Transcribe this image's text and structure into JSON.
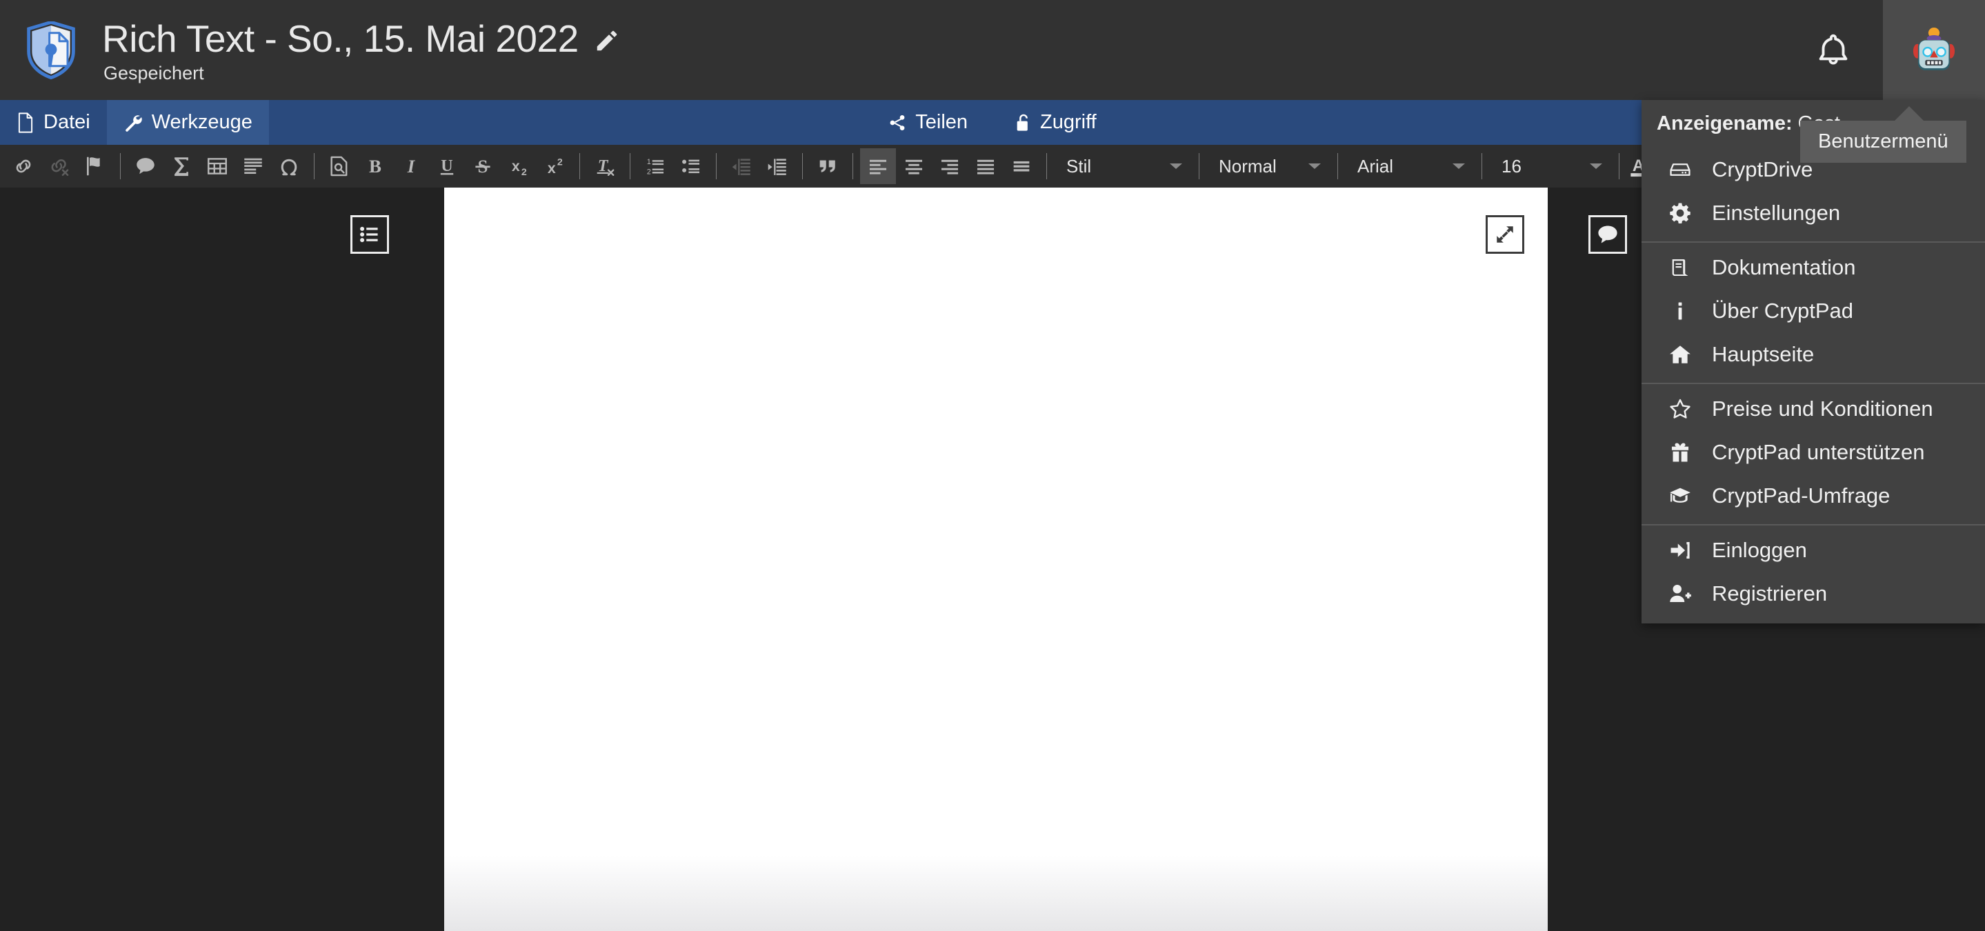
{
  "header": {
    "logo_icon": "cryptpad-shield-logo",
    "document_title": "Rich Text - So., 15. Mai 2022",
    "edit_title_icon": "pencil-icon",
    "save_status": "Gespeichert",
    "notifications_icon": "bell-icon",
    "avatar_icon": "robot-avatar",
    "avatar_emoji": "🤖"
  },
  "bluebar": {
    "left_items": [
      {
        "label": "Datei",
        "icon": "file-icon",
        "active": false
      },
      {
        "label": "Werkzeuge",
        "icon": "wrench-icon",
        "active": true
      }
    ],
    "center_items": [
      {
        "label": "Teilen",
        "icon": "share-icon"
      },
      {
        "label": "Zugriff",
        "icon": "lock-open-icon"
      }
    ]
  },
  "toolbar": {
    "buttons": [
      {
        "name": "link-icon",
        "state": "normal"
      },
      {
        "name": "unlink-icon",
        "state": "dim"
      },
      {
        "name": "flag-icon",
        "state": "normal"
      },
      {
        "name": "comment-icon",
        "state": "normal"
      },
      {
        "name": "sigma-icon",
        "state": "normal"
      },
      {
        "name": "table-icon",
        "state": "normal"
      },
      {
        "name": "paragraph-lines-icon",
        "state": "normal"
      },
      {
        "name": "omega-icon",
        "state": "normal"
      },
      {
        "name": "page-preview-icon",
        "state": "normal"
      },
      {
        "name": "bold-icon",
        "state": "normal"
      },
      {
        "name": "italic-icon",
        "state": "normal"
      },
      {
        "name": "underline-icon",
        "state": "normal"
      },
      {
        "name": "strikethrough-icon",
        "state": "normal"
      },
      {
        "name": "subscript-icon",
        "state": "normal"
      },
      {
        "name": "superscript-icon",
        "state": "normal"
      },
      {
        "name": "remove-format-icon",
        "state": "normal"
      },
      {
        "name": "numbered-list-icon",
        "state": "normal"
      },
      {
        "name": "bullet-list-icon",
        "state": "normal"
      },
      {
        "name": "outdent-icon",
        "state": "dim"
      },
      {
        "name": "indent-icon",
        "state": "normal"
      },
      {
        "name": "blockquote-icon",
        "state": "normal"
      },
      {
        "name": "align-left-icon",
        "state": "active"
      },
      {
        "name": "align-center-icon",
        "state": "normal"
      },
      {
        "name": "align-right-icon",
        "state": "normal"
      },
      {
        "name": "align-justify-icon",
        "state": "normal"
      },
      {
        "name": "paragraph-format-icon",
        "state": "normal"
      }
    ],
    "labels": {
      "bold": "B",
      "italic": "I",
      "underline": "U",
      "strike": "S",
      "highlight_letter": "A"
    },
    "selects": {
      "style": "Stil",
      "paragraph": "Normal",
      "font_family": "Arial",
      "font_size": "16"
    }
  },
  "canvas": {
    "outline_button_icon": "outline-list-icon",
    "expand_button_icon": "expand-arrows-icon",
    "comment_button_icon": "comment-bubble-icon",
    "document_body_text": ""
  },
  "usermenu": {
    "display_name_label": "Anzeigename:",
    "display_name_value": "Gast",
    "groups": [
      {
        "items": [
          {
            "label": "CryptDrive",
            "icon": "hard-drive-icon"
          },
          {
            "label": "Einstellungen",
            "icon": "gear-icon"
          }
        ]
      },
      {
        "items": [
          {
            "label": "Dokumentation",
            "icon": "book-icon"
          },
          {
            "label": "Über CryptPad",
            "icon": "info-icon"
          },
          {
            "label": "Hauptseite",
            "icon": "home-icon"
          }
        ]
      },
      {
        "items": [
          {
            "label": "Preise und Konditionen",
            "icon": "star-icon"
          },
          {
            "label": "CryptPad unterstützen",
            "icon": "gift-icon"
          },
          {
            "label": "CryptPad-Umfrage",
            "icon": "graduation-cap-icon"
          }
        ]
      },
      {
        "items": [
          {
            "label": "Einloggen",
            "icon": "sign-in-icon"
          },
          {
            "label": "Registrieren",
            "icon": "user-plus-icon"
          }
        ]
      }
    ]
  },
  "tooltip": {
    "text": "Benutzermenü"
  },
  "colors": {
    "header_bg": "#323232",
    "bluebar_bg": "#2a4a7d",
    "bluebar_active": "#35588d",
    "toolbar_bg": "#2d2d2d",
    "canvas_bg": "#222222",
    "menu_bg": "#414141",
    "tooltip_bg": "#5c5c5c",
    "page_bg": "#ffffff",
    "logo_blue": "#4a7fd4"
  }
}
